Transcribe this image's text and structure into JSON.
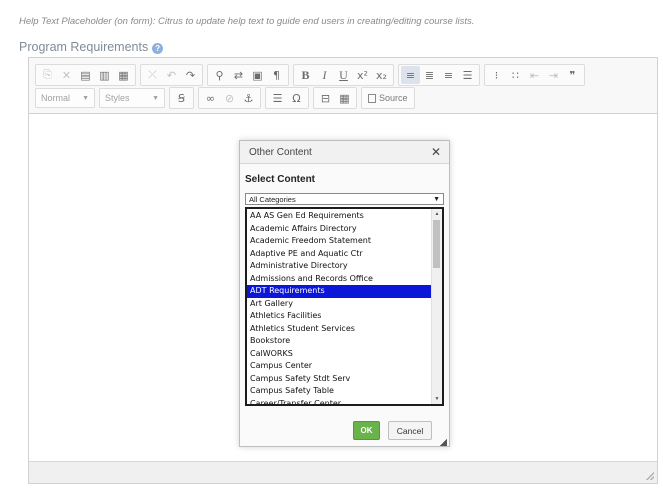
{
  "help_text": "Help Text Placeholder (on form): Citrus to update help text to guide end users in creating/editing course lists.",
  "field_label": "Program Requirements",
  "toolbar": {
    "format_combo": "Normal",
    "styles_combo": "Styles",
    "source_label": "Source"
  },
  "dialog": {
    "title": "Other Content",
    "close_glyph": "✕",
    "section_heading": "Select Content",
    "category_select": "All Categories",
    "items": [
      "AA AS Gen Ed Requirements",
      "Academic Affairs Directory",
      "Academic Freedom Statement",
      "Adaptive PE and Aquatic Ctr",
      "Administrative Directory",
      "Admissions and Records Office",
      "ADT Requirements",
      "Art Gallery",
      "Athletics Facilities",
      "Athletics Student Services",
      "Bookstore",
      "CalWORKS",
      "Campus Center",
      "Campus Safety Stdt Serv",
      "Campus Safety Table",
      "Career/Transfer Center"
    ],
    "selected_item": "ADT Requirements",
    "ok_label": "OK",
    "cancel_label": "Cancel"
  },
  "colors": {
    "selection_bg": "#0b16d8",
    "ok_button": "#6ab24a"
  }
}
